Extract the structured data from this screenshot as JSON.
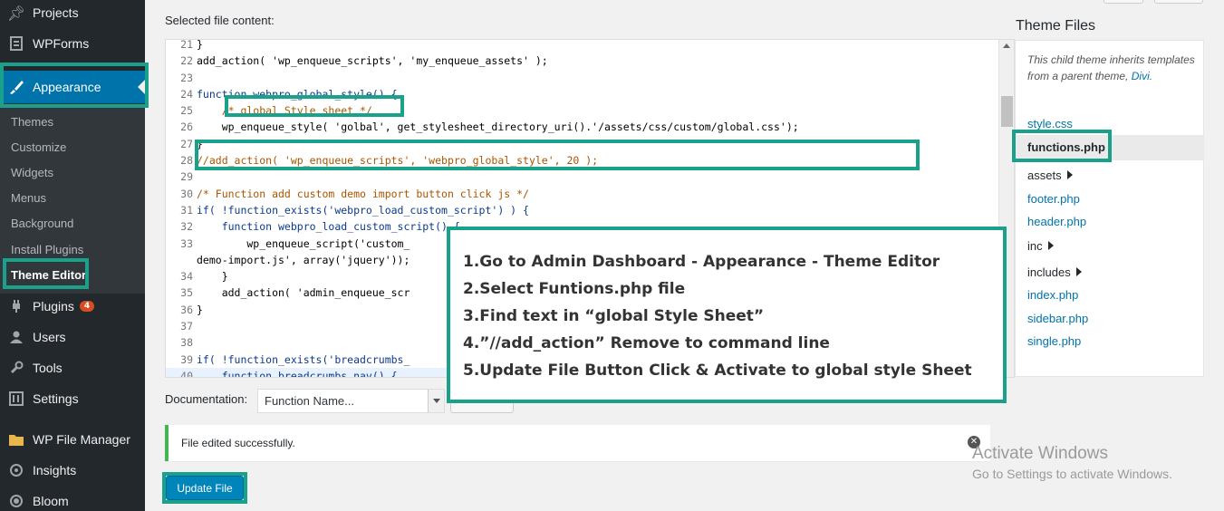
{
  "sidebar": {
    "items": [
      {
        "label": "Projects",
        "icon": "pin-icon"
      },
      {
        "label": "WPForms",
        "icon": "form-icon"
      },
      {
        "label": "Appearance",
        "icon": "paintbrush-icon"
      },
      {
        "label": "Plugins",
        "icon": "plug-icon",
        "badge": "4"
      },
      {
        "label": "Users",
        "icon": "user-icon"
      },
      {
        "label": "Tools",
        "icon": "wrench-icon"
      },
      {
        "label": "Settings",
        "icon": "settings-icon"
      },
      {
        "label": "WP File Manager",
        "icon": "folder-icon"
      },
      {
        "label": "Insights",
        "icon": "insights-icon"
      },
      {
        "label": "Bloom",
        "icon": "bloom-icon"
      }
    ],
    "submenu": [
      "Themes",
      "Customize",
      "Widgets",
      "Menus",
      "Background",
      "Install Plugins",
      "Theme Editor"
    ]
  },
  "editor": {
    "selected_label": "Selected file content:",
    "lines": [
      {
        "n": "21",
        "t": "}"
      },
      {
        "n": "22",
        "t": "add_action( 'wp_enqueue_scripts', 'my_enqueue_assets' );"
      },
      {
        "n": "23",
        "t": ""
      },
      {
        "n": "24",
        "t": "function webpro_global_style() {"
      },
      {
        "n": "25",
        "t": "    /* global Style sheet */"
      },
      {
        "n": "26",
        "t": "    wp_enqueue_style( 'golbal', get_stylesheet_directory_uri().'/assets/css/custom/global.css');"
      },
      {
        "n": "27",
        "t": "}"
      },
      {
        "n": "28",
        "t": "//add_action( 'wp_enqueue_scripts', 'webpro_global_style', 20 );"
      },
      {
        "n": "29",
        "t": ""
      },
      {
        "n": "30",
        "t": "/* Function add custom demo import button click js */"
      },
      {
        "n": "31",
        "t": "if( !function_exists('webpro_load_custom_script') ) {"
      },
      {
        "n": "32",
        "t": "    function webpro_load_custom_script() {"
      },
      {
        "n": "33",
        "t": "        wp_enqueue_script('custom_"
      },
      {
        "n": "",
        "t": "demo-import.js', array('jquery'));"
      },
      {
        "n": "34",
        "t": "    }"
      },
      {
        "n": "35",
        "t": "    add_action( 'admin_enqueue_scr"
      },
      {
        "n": "36",
        "t": "}"
      },
      {
        "n": "37",
        "t": ""
      },
      {
        "n": "38",
        "t": ""
      },
      {
        "n": "39",
        "t": "if( !function_exists('breadcrumbs_"
      },
      {
        "n": "40",
        "t": "    function breadcrumbs_nav() {"
      }
    ]
  },
  "theme_files": {
    "title": "Theme Files",
    "note": "This child theme inherits templates from a parent theme,",
    "note_link": "Divi.",
    "files": [
      {
        "label": "style.css",
        "folder": false
      },
      {
        "label": "functions.php",
        "folder": false,
        "active": true
      },
      {
        "label": "assets",
        "folder": true
      },
      {
        "label": "footer.php",
        "folder": false
      },
      {
        "label": "header.php",
        "folder": false
      },
      {
        "label": "inc",
        "folder": true
      },
      {
        "label": "includes",
        "folder": true
      },
      {
        "label": "index.php",
        "folder": false
      },
      {
        "label": "sidebar.php",
        "folder": false
      },
      {
        "label": "single.php",
        "folder": false
      }
    ]
  },
  "documentation": {
    "label": "Documentation:",
    "select_value": "Function Name..."
  },
  "notice": {
    "text": "File edited successfully."
  },
  "update_button": "Update File",
  "watermark": {
    "line1": "Activate Windows",
    "line2": "Go to Settings to activate Windows."
  },
  "instructions": [
    "1.Go to Admin Dashboard - Appearance - Theme Editor",
    "2.Select Funtions.php file",
    "3.Find text in “global Style Sheet”",
    "4.”//add_action” Remove to command line",
    "5.Update File Button Click & Activate to global style Sheet"
  ],
  "colors": {
    "sidebar_bg": "#23282d",
    "accent": "#0073aa",
    "annotation": "#1aa18c",
    "notice_success": "#46b450"
  }
}
